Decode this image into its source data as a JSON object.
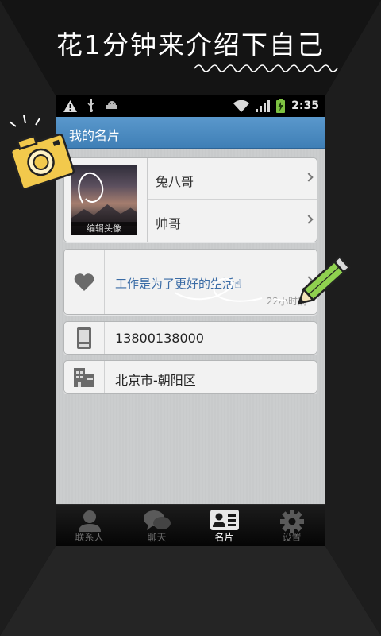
{
  "headline": "花1分钟来介绍下自己",
  "status_bar": {
    "time": "2:35",
    "icons": [
      "warning-icon",
      "usb-icon",
      "android-debug-icon",
      "wifi-icon",
      "signal-icon",
      "battery-charging-icon"
    ]
  },
  "title_bar": {
    "title": "我的名片"
  },
  "profile": {
    "avatar_caption": "编辑头像",
    "name": "兔八哥",
    "nickname": "帅哥"
  },
  "signature": {
    "text": "工作是为了更好的生活☝",
    "time": "22小时前"
  },
  "phone": {
    "number": "13800138000"
  },
  "address": {
    "location": "北京市-朝阳区"
  },
  "tabs": [
    {
      "label": "联系人",
      "icon": "contacts-icon",
      "active": false
    },
    {
      "label": "聊天",
      "icon": "chat-icon",
      "active": false
    },
    {
      "label": "名片",
      "icon": "card-icon",
      "active": true
    },
    {
      "label": "设置",
      "icon": "settings-gear-icon",
      "active": false
    }
  ],
  "colors": {
    "title_bar": "#4a8bc2",
    "signature_text": "#3b6ca6",
    "tab_active": "#ffffff",
    "tab_inactive": "#6c6c6c"
  }
}
